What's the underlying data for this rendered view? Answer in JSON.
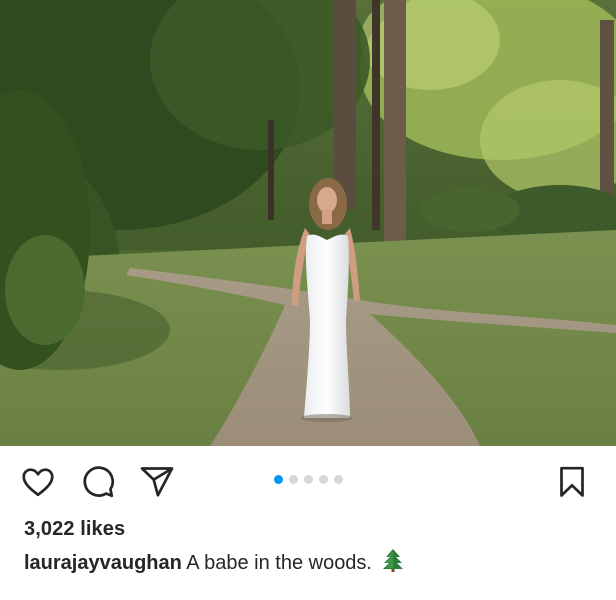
{
  "post": {
    "image": {
      "description_icon": "photo"
    },
    "actions": {
      "like_icon": "heart-outline-icon",
      "comment_icon": "speech-bubble-icon",
      "share_icon": "paper-plane-icon",
      "save_icon": "bookmark-outline-icon"
    },
    "carousel": {
      "total": 5,
      "active_index": 0,
      "active_color": "#0095f6",
      "inactive_color": "#d6d6d6"
    },
    "likes_text": "3,022 likes",
    "caption": {
      "username": "laurajayvaughan",
      "text": "A babe in the woods.",
      "emoji_icon": "evergreen-tree-emoji"
    }
  }
}
